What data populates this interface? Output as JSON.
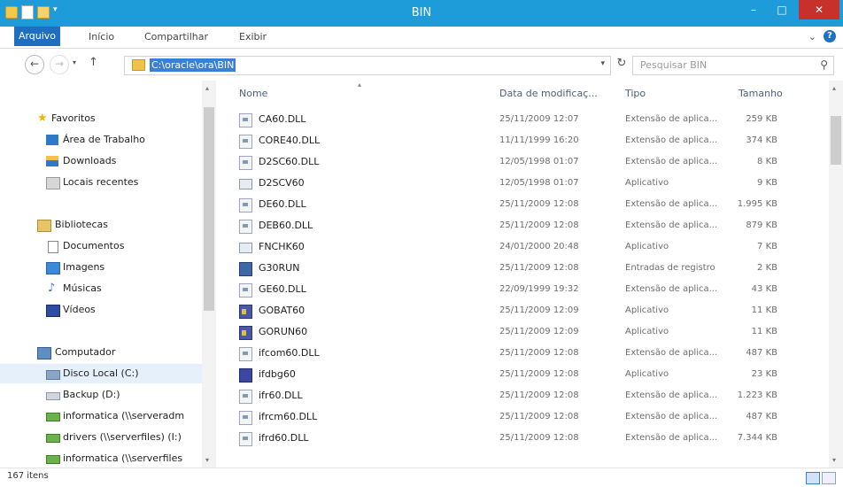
{
  "window": {
    "title": "BIN",
    "minimize": "–",
    "maximize": "□",
    "close": "✕"
  },
  "quick_access": {
    "dropdown": "▾"
  },
  "ribbon": {
    "tabs": [
      "Arquivo",
      "Início",
      "Compartilhar",
      "Exibir"
    ],
    "expand": "⌄",
    "help": "?"
  },
  "address": {
    "back": "←",
    "forward": "→",
    "history": "▾",
    "up": "↑",
    "path": "C:\\oracle\\ora\\BIN",
    "dropdown": "▾",
    "refresh": "↻",
    "search_placeholder": "Pesquisar BIN",
    "search_icon": "⚲"
  },
  "nav": {
    "favorites": "Favoritos",
    "favorites_items": [
      "Área de Trabalho",
      "Downloads",
      "Locais recentes"
    ],
    "libraries": "Bibliotecas",
    "libraries_items": [
      "Documentos",
      "Imagens",
      "Músicas",
      "Vídeos"
    ],
    "computer": "Computador",
    "computer_items": [
      "Disco Local (C:)",
      "Backup (D:)",
      "informatica (\\\\serveradm",
      "drivers (\\\\serverfiles) (I:)",
      "informatica (\\\\serverfiles"
    ]
  },
  "columns": {
    "name": "Nome",
    "date": "Data de modificaç...",
    "type": "Tipo",
    "size": "Tamanho"
  },
  "files": [
    {
      "name": "CA60.DLL",
      "date": "25/11/2009 12:07",
      "type": "Extensão de aplica...",
      "size": "259 KB",
      "icon": "dll-icon"
    },
    {
      "name": "CORE40.DLL",
      "date": "11/11/1999 16:20",
      "type": "Extensão de aplica...",
      "size": "374 KB",
      "icon": "dll-icon"
    },
    {
      "name": "D2SC60.DLL",
      "date": "12/05/1998 01:07",
      "type": "Extensão de aplica...",
      "size": "8 KB",
      "icon": "dll-icon"
    },
    {
      "name": "D2SCV60",
      "date": "12/05/1998 01:07",
      "type": "Aplicativo",
      "size": "9 KB",
      "icon": "app-icon"
    },
    {
      "name": "DE60.DLL",
      "date": "25/11/2009 12:08",
      "type": "Extensão de aplica...",
      "size": "1.995 KB",
      "icon": "dll-icon"
    },
    {
      "name": "DEB60.DLL",
      "date": "25/11/2009 12:08",
      "type": "Extensão de aplica...",
      "size": "879 KB",
      "icon": "dll-icon"
    },
    {
      "name": "FNCHK60",
      "date": "24/01/2000 20:48",
      "type": "Aplicativo",
      "size": "7 KB",
      "icon": "app-icon"
    },
    {
      "name": "G30RUN",
      "date": "25/11/2009 12:08",
      "type": "Entradas de registro",
      "size": "2 KB",
      "icon": "registry-icon"
    },
    {
      "name": "GE60.DLL",
      "date": "22/09/1999 19:32",
      "type": "Extensão de aplica...",
      "size": "43 KB",
      "icon": "dll-icon"
    },
    {
      "name": "GOBAT60",
      "date": "25/11/2009 12:09",
      "type": "Aplicativo",
      "size": "11 KB",
      "icon": "forms-app-icon"
    },
    {
      "name": "GORUN60",
      "date": "25/11/2009 12:09",
      "type": "Aplicativo",
      "size": "11 KB",
      "icon": "forms-app-icon"
    },
    {
      "name": "ifcom60.DLL",
      "date": "25/11/2009 12:08",
      "type": "Extensão de aplica...",
      "size": "487 KB",
      "icon": "dll-icon"
    },
    {
      "name": "ifdbg60",
      "date": "25/11/2009 12:08",
      "type": "Aplicativo",
      "size": "23 KB",
      "icon": "debugger-icon"
    },
    {
      "name": "ifr60.DLL",
      "date": "25/11/2009 12:08",
      "type": "Extensão de aplica...",
      "size": "1.223 KB",
      "icon": "dll-icon"
    },
    {
      "name": "ifrcm60.DLL",
      "date": "25/11/2009 12:08",
      "type": "Extensão de aplica...",
      "size": "487 KB",
      "icon": "dll-icon"
    },
    {
      "name": "ifrd60.DLL",
      "date": "25/11/2009 12:08",
      "type": "Extensão de aplica...",
      "size": "7.344 KB",
      "icon": "dll-icon"
    }
  ],
  "status": {
    "items": "167 itens"
  },
  "scroll": {
    "up": "▴",
    "down": "▾"
  }
}
